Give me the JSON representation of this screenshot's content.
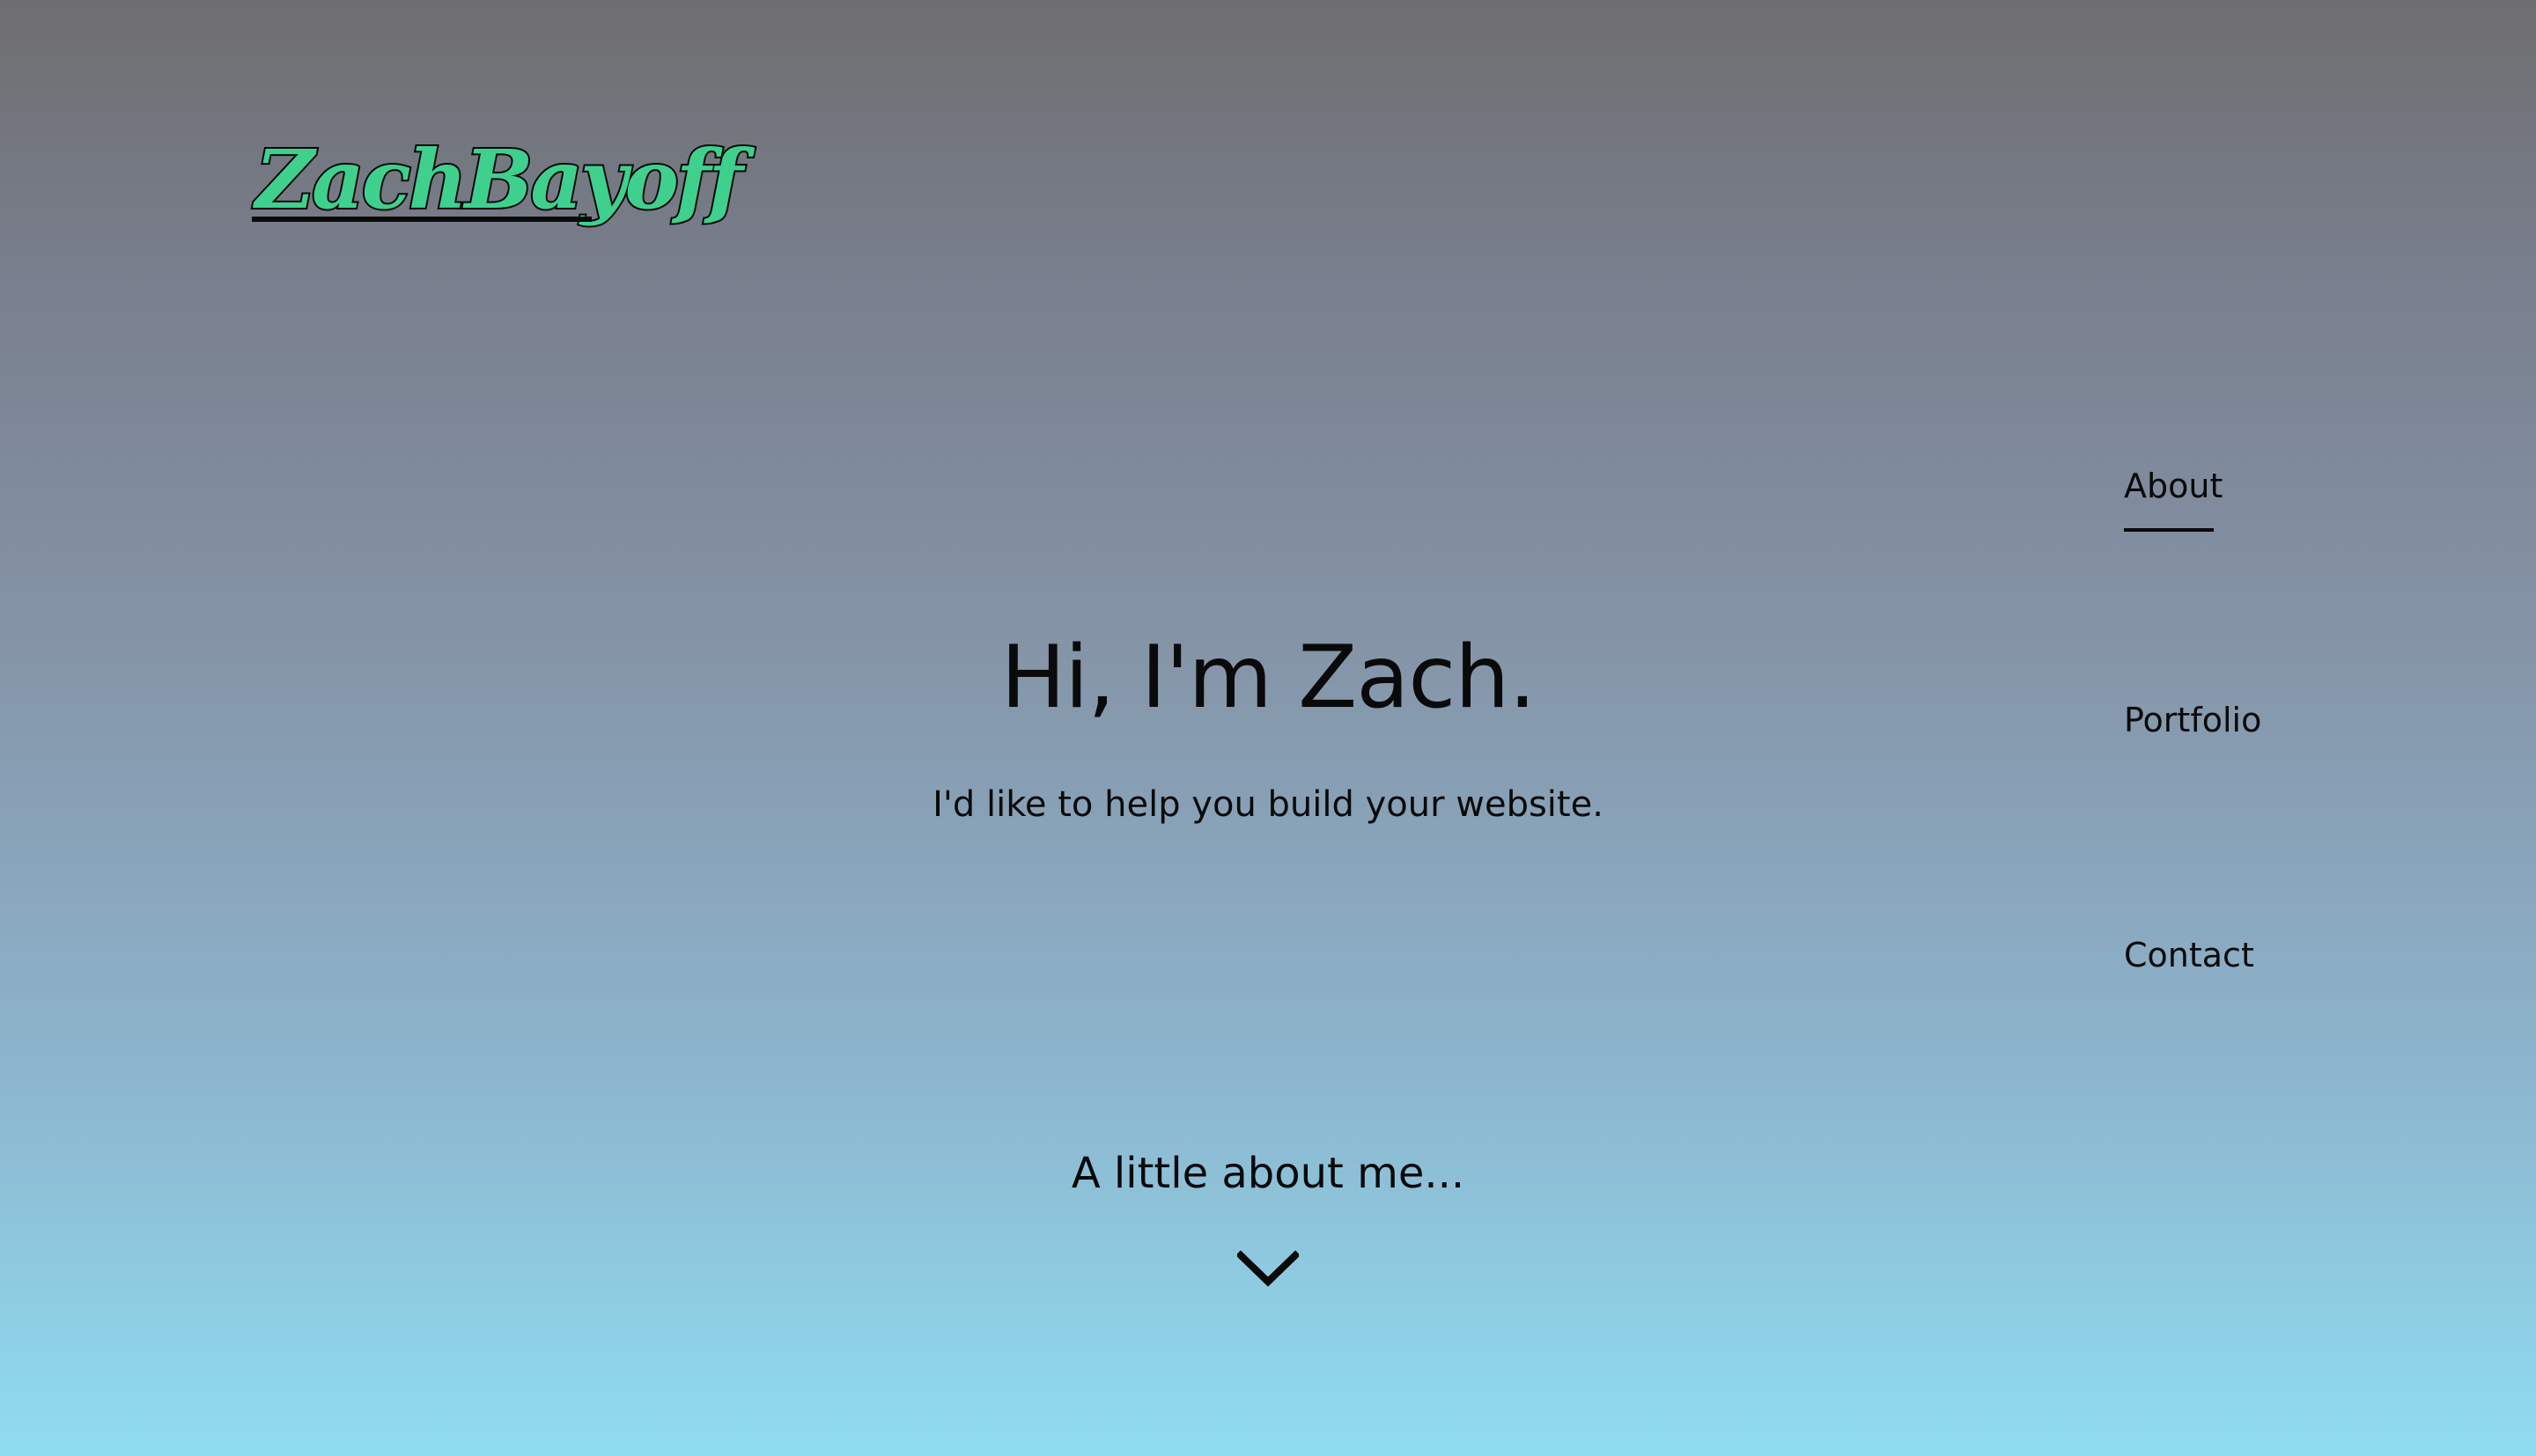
{
  "logo": {
    "text": "ZachBayoff",
    "fill_color": "#3fd08e",
    "stroke_color": "#0a0a0a"
  },
  "nav": {
    "items": [
      {
        "label": "About",
        "active": true
      },
      {
        "label": "Portfolio",
        "active": false
      },
      {
        "label": "Contact",
        "active": false
      }
    ]
  },
  "hero": {
    "title": "Hi, I'm Zach.",
    "subtitle": "I'd like to help you build your website."
  },
  "about_prompt": {
    "label": "A little about me...",
    "icon": "chevron-down-icon"
  },
  "colors": {
    "gradient_top": "#6e6e6f",
    "gradient_bottom": "#8fdcf0",
    "text": "#0a0a0a"
  }
}
